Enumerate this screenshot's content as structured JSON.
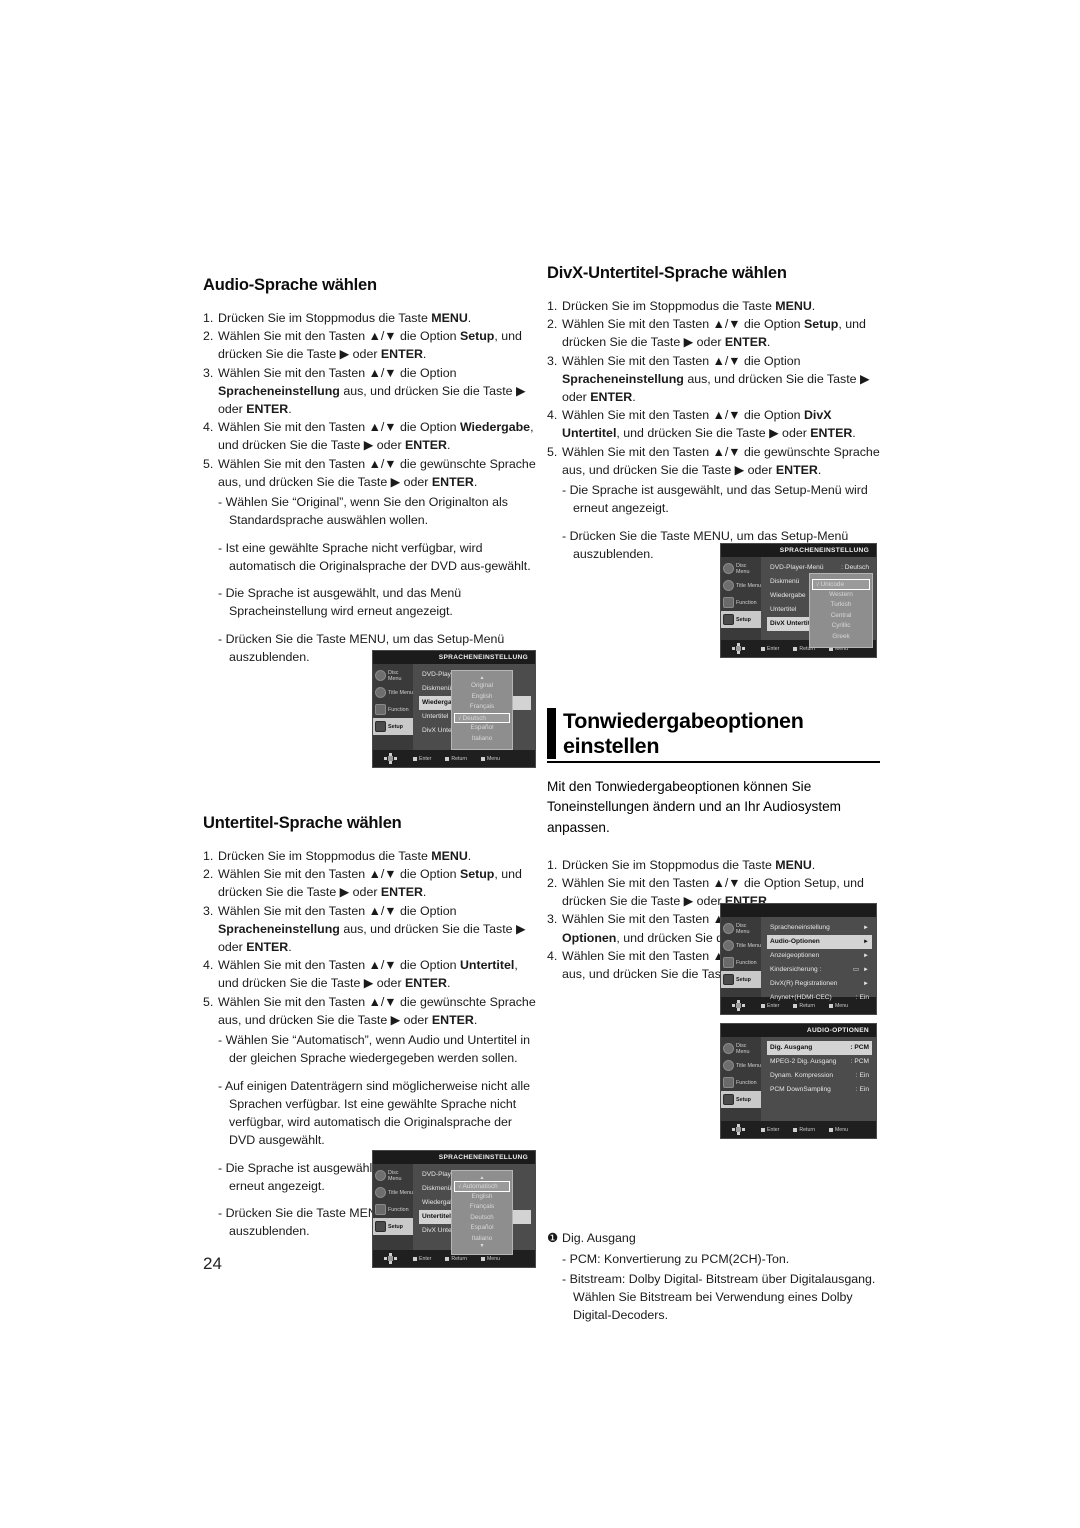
{
  "page": {
    "number": "24"
  },
  "left_column": {
    "section1": {
      "title": "Audio-Sprache wählen",
      "steps": [
        {
          "num": "1.",
          "html": "Drücken Sie im Stoppmodus die Taste <b>MENU</b>."
        },
        {
          "num": "2.",
          "html": "Wählen Sie mit den Tasten ▲/▼ die Option <b>Setup</b>, und drücken Sie die Taste ▶ oder <b>ENTER</b>."
        },
        {
          "num": "3.",
          "html": "Wählen Sie mit den Tasten ▲/▼ die Option <b>Spracheneinstellung</b> aus, und drücken Sie die Taste ▶ oder <b>ENTER</b>."
        },
        {
          "num": "4.",
          "html": "Wählen Sie mit den Tasten ▲/▼ die Option <b>Wiedergabe</b>, und drücken Sie die Taste ▶ oder <b>ENTER</b>."
        },
        {
          "num": "5.",
          "html": "Wählen Sie mit den Tasten ▲/▼ die gewünschte Sprache aus, und drücken Sie die Taste ▶ oder <b>ENTER</b>."
        }
      ],
      "subs": [
        "- Wählen Sie “Original”, wenn Sie den Originalton als Standardsprache auswählen wollen.",
        "- Ist eine gewählte Sprache nicht verfügbar, wird automatisch die Originalsprache der DVD aus-gewählt.",
        "- Die Sprache ist ausgewählt, und das Menü Spracheinstellung wird erneut angezeigt.",
        "- Drücken Sie die Taste MENU, um das Setup-Menü auszublenden."
      ]
    },
    "section2": {
      "title": "Untertitel-Sprache wählen",
      "steps": [
        {
          "num": "1.",
          "html": "Drücken Sie im Stoppmodus die Taste <b>MENU</b>."
        },
        {
          "num": "2.",
          "html": "Wählen Sie mit den Tasten ▲/▼ die Option <b>Setup</b>, und drücken Sie die Taste ▶ oder <b>ENTER</b>."
        },
        {
          "num": "3.",
          "html": "Wählen Sie mit den Tasten ▲/▼ die Option <b>Spracheneinstellung</b> aus, und drücken Sie die Taste ▶ oder <b>ENTER</b>."
        },
        {
          "num": "4.",
          "html": "Wählen Sie mit den Tasten ▲/▼ die Option <b>Untertitel</b>, und drücken Sie die Taste ▶ oder <b>ENTER</b>."
        },
        {
          "num": "5.",
          "html": "Wählen Sie mit den Tasten ▲/▼ die gewünschte Sprache aus, und drücken Sie die Taste ▶ oder <b>ENTER</b>."
        }
      ],
      "subs": [
        "- Wählen Sie “Automatisch”, wenn Audio und Untertitel in der gleichen Sprache wiedergegeben werden sollen.",
        "- Auf einigen Datenträgern sind möglicherweise nicht alle Sprachen verfügbar. Ist eine gewählte Sprache nicht verfügbar, wird automatisch die Originalsprache der DVD ausgewählt.",
        "- Die Sprache ist ausgewählt, und das Setup-Menü wird erneut angezeigt.",
        "- Drücken Sie die Taste MENU, um das Setup-Menü auszublenden."
      ]
    }
  },
  "right_column": {
    "section1": {
      "title": "DivX-Untertitel-Sprache wählen",
      "steps": [
        {
          "num": "1.",
          "html": "Drücken Sie im Stoppmodus die Taste <b>MENU</b>."
        },
        {
          "num": "2.",
          "html": "Wählen Sie mit den Tasten ▲/▼ die Option <b>Setup</b>, und drücken Sie die Taste ▶ oder <b>ENTER</b>."
        },
        {
          "num": "3.",
          "html": "Wählen Sie mit den Tasten ▲/▼ die Option <b>Spracheneinstellung</b> aus, und drücken Sie die Taste ▶ oder <b>ENTER</b>."
        },
        {
          "num": "4.",
          "html": "Wählen Sie mit den Tasten ▲/▼  die Option <b>DivX Untertitel</b>, und drücken Sie die Taste ▶ oder <b>ENTER</b>."
        },
        {
          "num": "5.",
          "html": "Wählen Sie mit den Tasten ▲/▼ die gewünschte Sprache aus, und drücken Sie die Taste ▶ oder <b>ENTER</b>."
        }
      ],
      "subs": [
        "- Die Sprache ist ausgewählt, und das Setup-Menü wird erneut angezeigt.",
        "- Drücken Sie die Taste MENU, um das Setup-Menü auszublenden."
      ]
    },
    "chapter": {
      "line1": "Tonwiedergabeoptionen",
      "line2": "einstellen"
    },
    "intro": "Mit den Tonwiedergabeoptionen können Sie Toneinstellungen ändern und an Ihr Audiosystem anpassen.",
    "section2": {
      "steps": [
        {
          "num": "1.",
          "html": "Drücken Sie im Stoppmodus die Taste <b>MENU</b>."
        },
        {
          "num": "2.",
          "html": "Wählen Sie mit den Tasten ▲/▼ die Option Setup, und drücken Sie die Taste ▶ oder <b>ENTER</b>."
        },
        {
          "num": "3.",
          "html": "Wählen Sie mit den Tasten ▲/▼ die Option <b>Audio-Optionen</b>, und drücken Sie die Taste ▶ oder <b>ENTER</b>."
        },
        {
          "num": "4.",
          "html": "Wählen Sie mit den Tasten ▲/▼ die gewünschte Option aus, und drücken Sie die Taste ▶ oder <b>ENTER</b>."
        }
      ]
    },
    "note": {
      "bullet": "❶",
      "title": "Dig. Ausgang",
      "lines": [
        "- PCM: Konvertierung zu PCM(2CH)-Ton.",
        "- Bitstream: Dolby Digital- Bitstream über Digitalausgang. Wählen Sie Bitstream bei Verwendung eines Dolby Digital-Decoders."
      ]
    }
  },
  "osd_rail": {
    "items": [
      {
        "label": "Disc Menu",
        "shape": "disc"
      },
      {
        "label": "Title Menu",
        "shape": "disc"
      },
      {
        "label": "Function",
        "shape": "sq"
      },
      {
        "label": "Setup",
        "shape": "sq"
      }
    ]
  },
  "osd_footer": {
    "items": [
      "Enter",
      "Return",
      "Menu"
    ]
  },
  "screenshots": {
    "audio_language": {
      "header": "SPRACHENEINSTELLUNG",
      "rows": [
        {
          "label": "DVD-Player-M",
          "value": "",
          "highlight": false
        },
        {
          "label": "Diskmenü",
          "value": "",
          "highlight": false
        },
        {
          "label": "Wiedergabe",
          "value": "",
          "highlight": true
        },
        {
          "label": "Untertitel",
          "value": "",
          "highlight": false
        },
        {
          "label": "DivX Untertite",
          "value": "",
          "highlight": false
        }
      ],
      "active_rail": "Setup",
      "dropdown": {
        "top_caret": "▲",
        "bottom_caret": "",
        "options": [
          "Original",
          "English",
          "Français",
          "Deutsch",
          "Español",
          "Italiano"
        ],
        "selected": "Deutsch"
      }
    },
    "subtitle_language": {
      "header": "SPRACHENEINSTELLUNG",
      "rows": [
        {
          "label": "DVD-Player-M",
          "value": "",
          "highlight": false
        },
        {
          "label": "Diskmenü",
          "value": "",
          "highlight": false
        },
        {
          "label": "Wiedergabe",
          "value": "",
          "highlight": false
        },
        {
          "label": "Untertitel",
          "value": "",
          "highlight": true
        },
        {
          "label": "DivX Untertite",
          "value": "",
          "highlight": false
        }
      ],
      "active_rail": "Setup",
      "dropdown": {
        "top_caret": "▲",
        "bottom_caret": "▼",
        "options": [
          "Automatisch",
          "English",
          "Français",
          "Deutsch",
          "Español",
          "Italiano"
        ],
        "selected": "Automatisch"
      }
    },
    "divx_subtitle": {
      "header": "SPRACHENEINSTELLUNG",
      "rows": [
        {
          "label": "DVD-Player-Menü",
          "value": ": Deutsch",
          "highlight": false
        },
        {
          "label": "Diskmenü",
          "value": "",
          "highlight": false
        },
        {
          "label": "Wiedergabe",
          "value": "",
          "highlight": false
        },
        {
          "label": "Untertitel",
          "value": "",
          "highlight": false
        },
        {
          "label": "DivX Untertitel",
          "value": "",
          "highlight": true
        }
      ],
      "active_rail": "Setup",
      "dropdown": {
        "top_caret": "",
        "bottom_caret": "",
        "options": [
          "Unicode",
          "Western",
          "Turkish",
          "Central",
          "Cyrillic",
          "Greek"
        ],
        "selected": "Unicode"
      }
    },
    "setup_menu": {
      "header": "",
      "rows": [
        {
          "label": "Spracheneinstellung",
          "value": "",
          "arrow": "►",
          "highlight": false
        },
        {
          "label": "Audio-Optionen",
          "value": "",
          "arrow": "►",
          "highlight": true
        },
        {
          "label": "Anzeigeoptionen",
          "value": "",
          "arrow": "►",
          "highlight": false
        },
        {
          "label": "Kindersicherung :",
          "value": "▭",
          "arrow": "►",
          "highlight": false
        },
        {
          "label": "DivX(R) Registrationen",
          "value": "",
          "arrow": "►",
          "highlight": false
        },
        {
          "label": "Anynet+(HDMI-CEC)",
          "value": ": Ein",
          "arrow": "",
          "highlight": false
        }
      ],
      "active_rail": "Setup"
    },
    "audio_options": {
      "header": "AUDIO-OPTIONEN",
      "rows": [
        {
          "label": "Dig. Ausgang",
          "value": ": PCM",
          "highlight": true
        },
        {
          "label": "MPEG-2 Dig. Ausgang",
          "value": ": PCM",
          "highlight": false
        },
        {
          "label": "Dynam. Kompression",
          "value": ": Ein",
          "highlight": false
        },
        {
          "label": "PCM DownSampling",
          "value": ": Ein",
          "highlight": false
        }
      ],
      "active_rail": "Setup"
    }
  }
}
